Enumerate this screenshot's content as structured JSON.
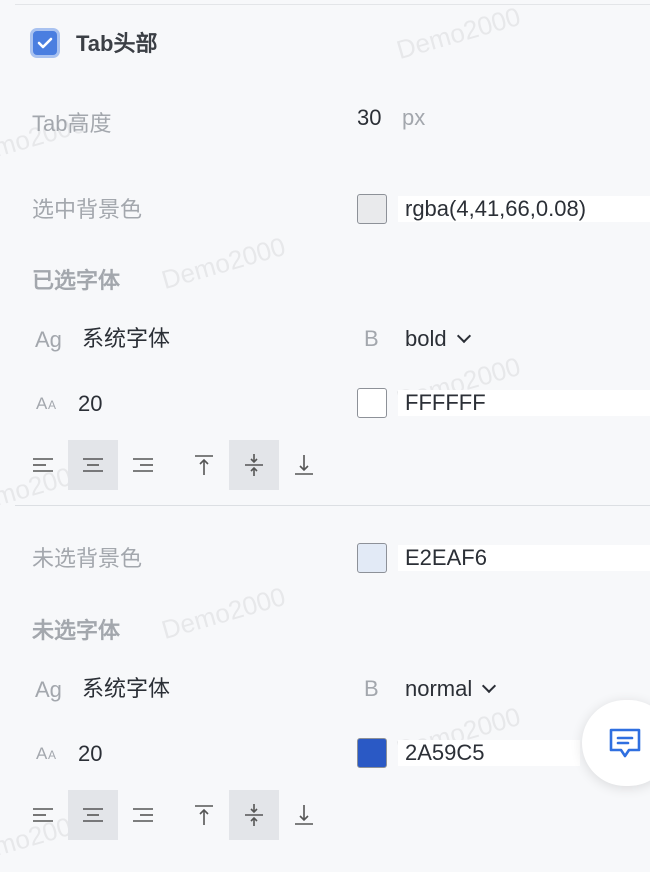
{
  "header": {
    "title": "Tab头部",
    "checked": true
  },
  "tab_height": {
    "label": "Tab高度",
    "value": "30",
    "unit": "px"
  },
  "selected_bg": {
    "label": "选中背景色",
    "value": "rgba(4,41,66,0.08)",
    "swatch_color": "#e9eaec"
  },
  "selected_font": {
    "section_label": "已选字体",
    "family_icon": "Ag",
    "family": "系统字体",
    "weight_icon": "B",
    "weight": "bold",
    "size_icon": "font-size-icon",
    "size": "20",
    "color": "FFFFFF",
    "color_hex": "#ffffff",
    "h_align": "center",
    "v_align": "middle"
  },
  "unselected_bg": {
    "label": "未选背景色",
    "value": "E2EAF6",
    "swatch_color": "#e2eaf6"
  },
  "unselected_font": {
    "section_label": "未选字体",
    "family_icon": "Ag",
    "family": "系统字体",
    "weight_icon": "B",
    "weight": "normal",
    "size_icon": "font-size-icon",
    "size": "20",
    "color": "2A59C5",
    "color_hex": "#2a59c5",
    "h_align": "center",
    "v_align": "middle"
  },
  "watermark_text": "Demo2000",
  "chat_button_icon": "chat-icon",
  "colors": {
    "accent": "#4a7ee0",
    "label_gray": "#a3a7ad"
  }
}
